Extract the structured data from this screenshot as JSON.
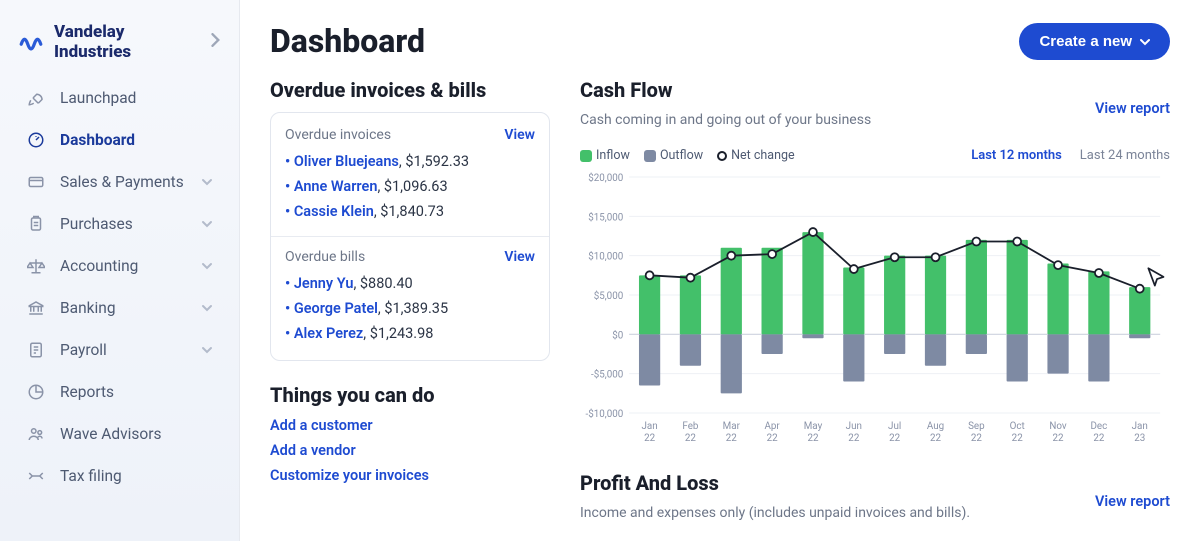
{
  "company_name": "Vandelay Industries",
  "nav": [
    {
      "label": "Launchpad",
      "icon": "rocket",
      "expandable": false,
      "active": false
    },
    {
      "label": "Dashboard",
      "icon": "gauge",
      "expandable": false,
      "active": true
    },
    {
      "label": "Sales & Payments",
      "icon": "card",
      "expandable": true,
      "active": false
    },
    {
      "label": "Purchases",
      "icon": "clipboard",
      "expandable": true,
      "active": false
    },
    {
      "label": "Accounting",
      "icon": "scales",
      "expandable": true,
      "active": false
    },
    {
      "label": "Banking",
      "icon": "bank",
      "expandable": true,
      "active": false
    },
    {
      "label": "Payroll",
      "icon": "paycheck",
      "expandable": true,
      "active": false
    },
    {
      "label": "Reports",
      "icon": "reports",
      "expandable": false,
      "active": false
    },
    {
      "label": "Wave Advisors",
      "icon": "advisors",
      "expandable": false,
      "active": false
    },
    {
      "label": "Tax filing",
      "icon": "taxes",
      "expandable": false,
      "active": false
    }
  ],
  "page_title": "Dashboard",
  "create_button": "Create a new",
  "overdue": {
    "heading": "Overdue invoices & bills",
    "invoices": {
      "title": "Overdue invoices",
      "view": "View",
      "rows": [
        {
          "name": "Oliver Bluejeans",
          "amount": "$1,592.33"
        },
        {
          "name": "Anne Warren",
          "amount": "$1,096.63"
        },
        {
          "name": "Cassie Klein",
          "amount": "$1,840.73"
        }
      ]
    },
    "bills": {
      "title": "Overdue bills",
      "view": "View",
      "rows": [
        {
          "name": "Jenny Yu",
          "amount": "$880.40"
        },
        {
          "name": "George Patel",
          "amount": "$1,389.35"
        },
        {
          "name": "Alex Perez",
          "amount": "$1,243.98"
        }
      ]
    }
  },
  "things": {
    "heading": "Things you can do",
    "items": [
      "Add a customer",
      "Add a vendor",
      "Customize your invoices"
    ]
  },
  "cashflow": {
    "heading": "Cash Flow",
    "sub": "Cash coming in and going out of your business",
    "view_report": "View report",
    "legend": {
      "inflow": "Inflow",
      "outflow": "Outflow",
      "net": "Net change"
    },
    "ranges": {
      "r12": "Last 12 months",
      "r24": "Last 24 months",
      "active": "r12"
    }
  },
  "pl": {
    "heading": "Profit And Loss",
    "sub": "Income and expenses only (includes unpaid invoices and bills).",
    "view_report": "View report"
  },
  "chart_data": {
    "type": "bar",
    "ylabel": "",
    "ylim": [
      -10000,
      20000
    ],
    "yticks": [
      -10000,
      -5000,
      0,
      5000,
      10000,
      15000,
      20000
    ],
    "ytick_labels": [
      "-$10,000",
      "-$5,000",
      "$0",
      "$5,000",
      "$10,000",
      "$15,000",
      "$20,000"
    ],
    "categories": [
      "Jan 22",
      "Feb 22",
      "Mar 22",
      "Apr 22",
      "May 22",
      "Jun 22",
      "Jul 22",
      "Aug 22",
      "Sep 22",
      "Oct 22",
      "Nov 22",
      "Dec 22",
      "Jan 23"
    ],
    "series": [
      {
        "name": "Inflow",
        "color": "#43c06a",
        "values": [
          7500,
          7500,
          11000,
          11000,
          13000,
          8500,
          10000,
          10000,
          12000,
          12000,
          9000,
          8000,
          6000
        ]
      },
      {
        "name": "Outflow",
        "color": "#7e8aa3",
        "values": [
          -6500,
          -4000,
          -7500,
          -2500,
          -500,
          -6000,
          -2500,
          -4000,
          -2500,
          -6000,
          -5000,
          -6000,
          -500
        ]
      }
    ],
    "net": {
      "name": "Net change",
      "color": "#1a1f2b",
      "values": [
        7500,
        7200,
        10000,
        10200,
        13000,
        8300,
        9800,
        9800,
        11800,
        11800,
        8800,
        7800,
        5800
      ]
    }
  }
}
